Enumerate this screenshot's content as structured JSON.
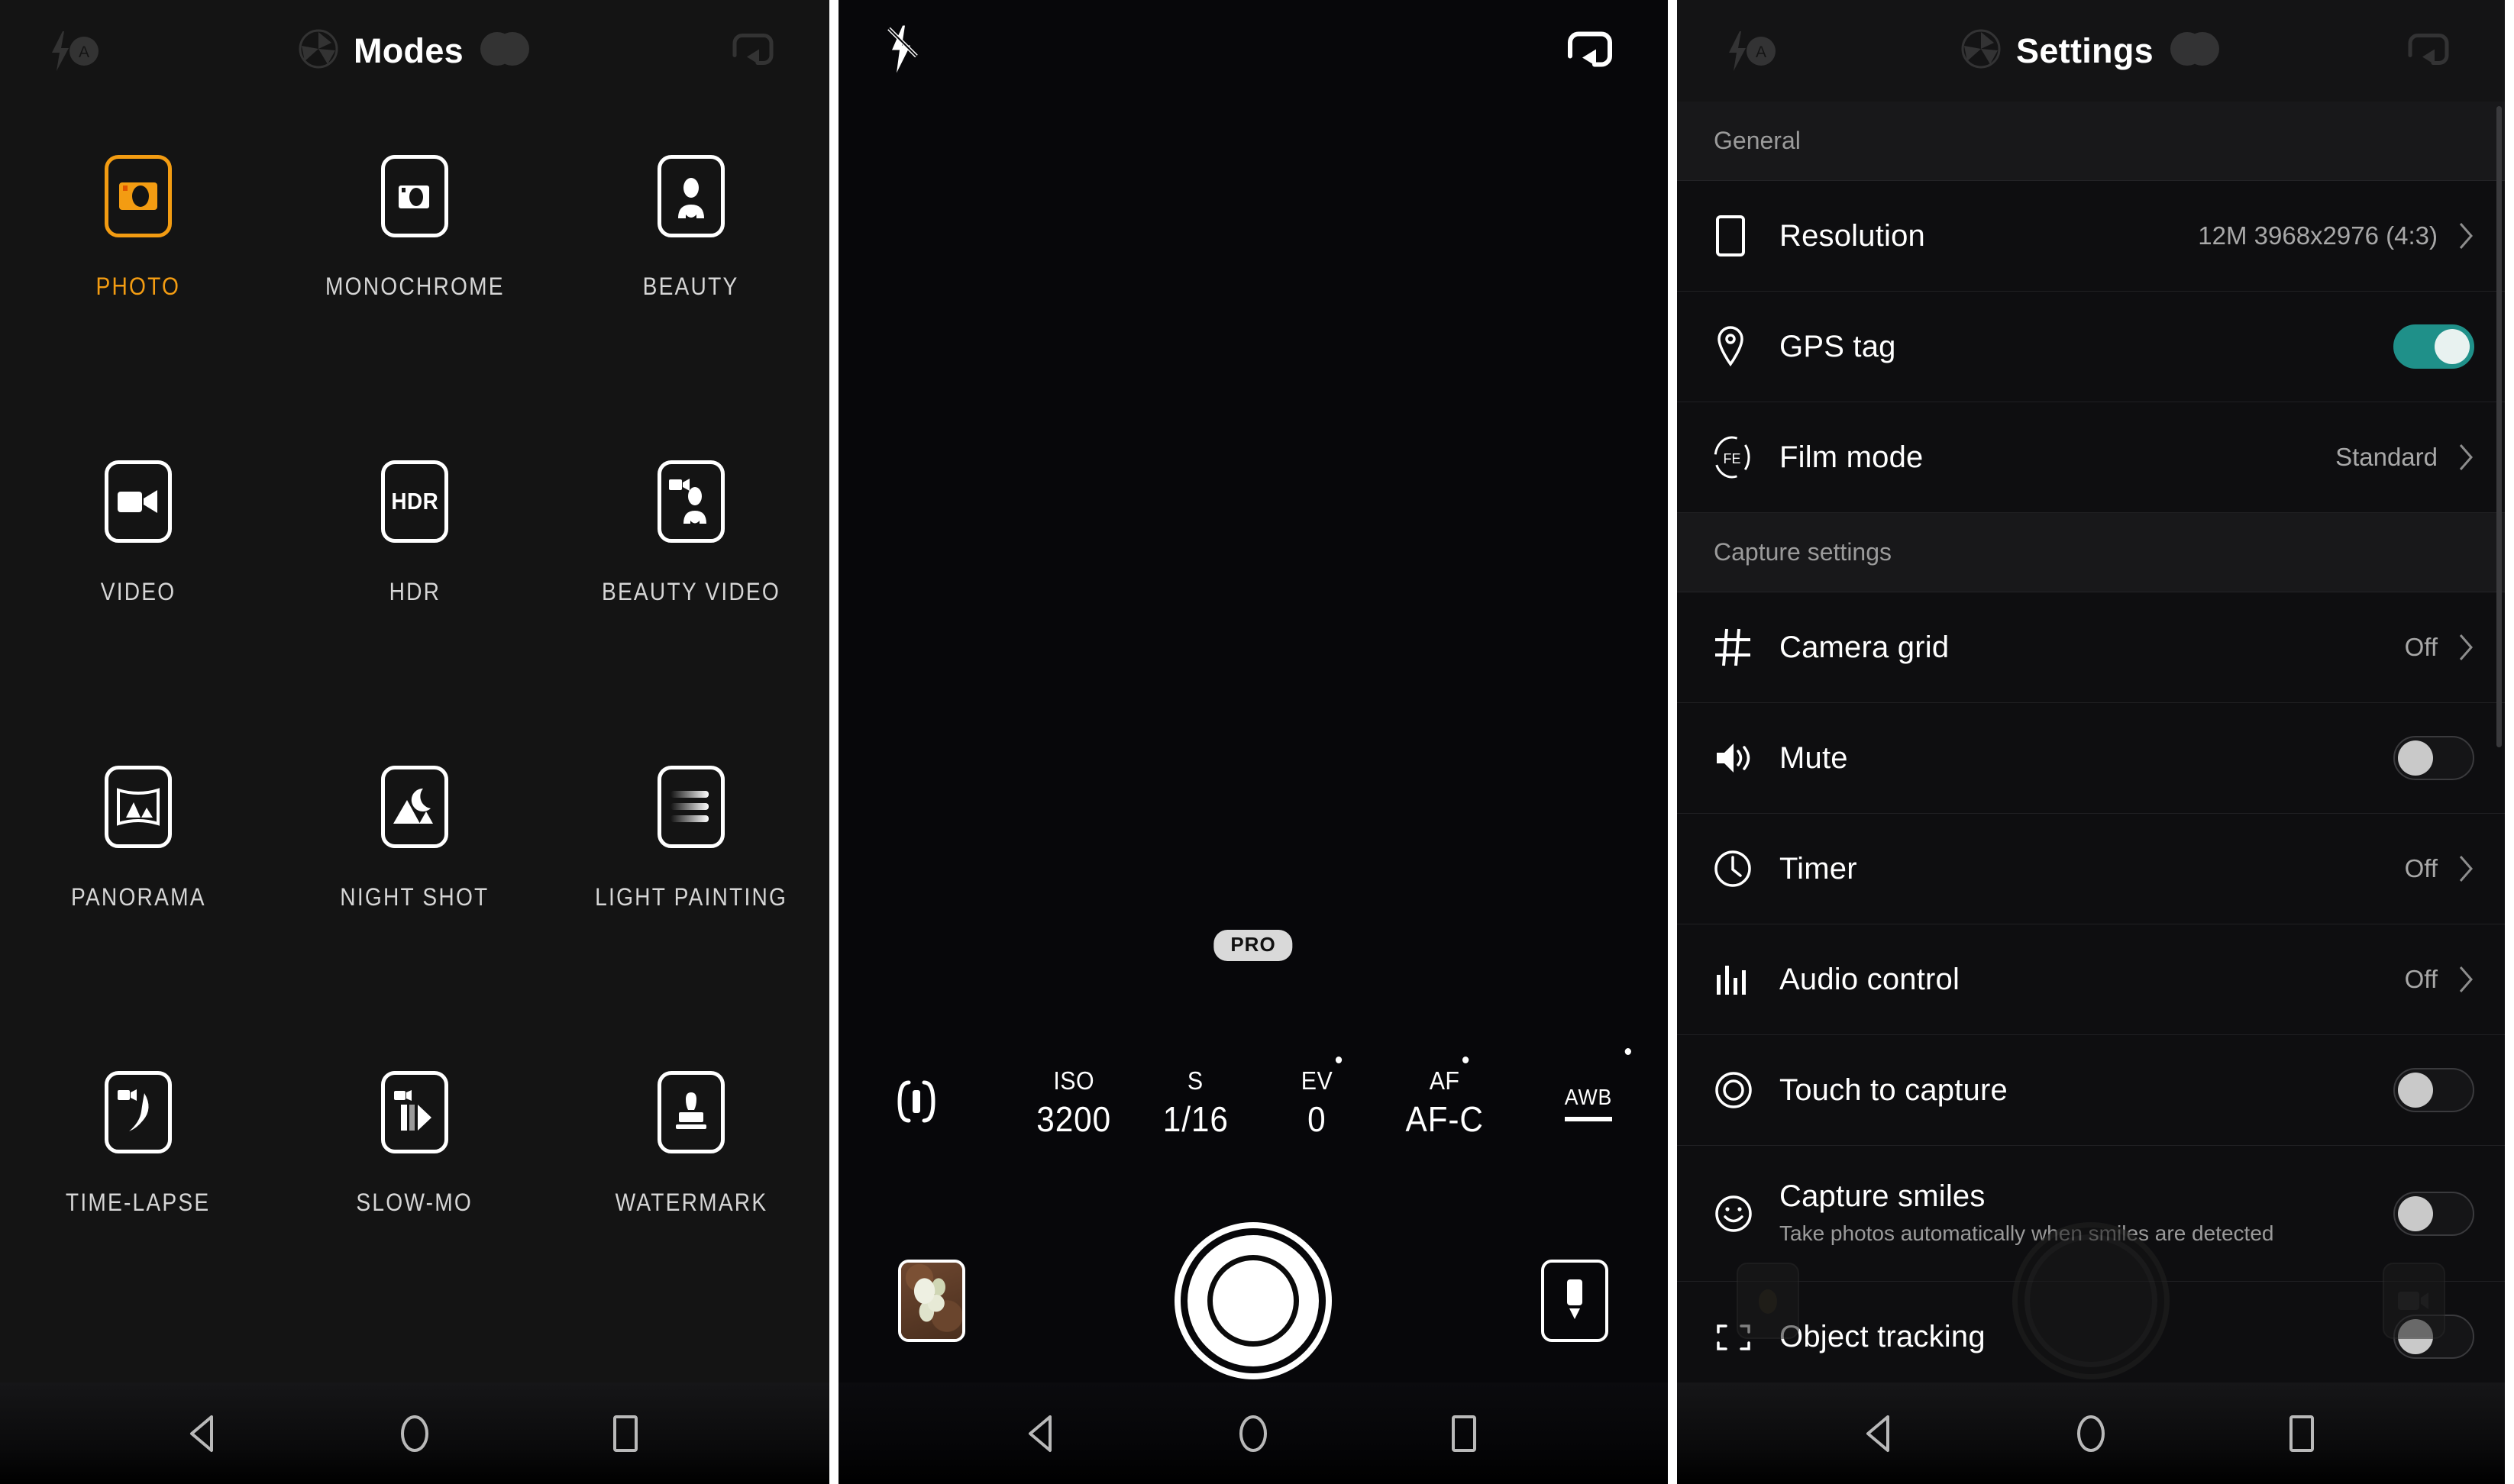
{
  "panels": {
    "modes": {
      "topbar": {
        "flash_icon": "flash-auto-icon",
        "aperture_icon": "aperture-icon",
        "title": "Modes",
        "filter_icon": "color-filter-icon",
        "switch_camera_icon": "switch-camera-icon"
      },
      "grid": [
        [
          {
            "label": "PHOTO",
            "icon": "photo-mode-icon",
            "selected": true
          },
          {
            "label": "MONOCHROME",
            "icon": "monochrome-mode-icon",
            "selected": false
          },
          {
            "label": "BEAUTY",
            "icon": "beauty-mode-icon",
            "selected": false
          }
        ],
        [
          {
            "label": "VIDEO",
            "icon": "video-mode-icon",
            "selected": false
          },
          {
            "label": "HDR",
            "icon": "hdr-mode-icon",
            "selected": false
          },
          {
            "label": "BEAUTY VIDEO",
            "icon": "beauty-video-mode-icon",
            "selected": false
          }
        ],
        [
          {
            "label": "PANORAMA",
            "icon": "panorama-mode-icon",
            "selected": false
          },
          {
            "label": "NIGHT SHOT",
            "icon": "night-shot-mode-icon",
            "selected": false
          },
          {
            "label": "LIGHT PAINTING",
            "icon": "light-painting-mode-icon",
            "selected": false
          }
        ],
        [
          {
            "label": "TIME-LAPSE",
            "icon": "time-lapse-mode-icon",
            "selected": false
          },
          {
            "label": "SLOW-MO",
            "icon": "slow-mo-mode-icon",
            "selected": false
          },
          {
            "label": "WATERMARK",
            "icon": "watermark-mode-icon",
            "selected": false
          }
        ]
      ],
      "hdr_badge_text": "HDR"
    },
    "viewfinder": {
      "topbar": {
        "flash_icon": "flash-off-icon",
        "switch_camera_icon": "switch-camera-icon"
      },
      "pro_badge": "PRO",
      "pro_controls": [
        {
          "key": "",
          "value": "",
          "icon": "metering-mode-icon",
          "name": "metering"
        },
        {
          "key": "ISO",
          "value": "3200",
          "name": "iso"
        },
        {
          "key": "S",
          "value": "1/16",
          "name": "shutter-speed"
        },
        {
          "key": "EV",
          "value": "0",
          "name": "exposure-value"
        },
        {
          "key": "AF",
          "value": "AF-C",
          "name": "focus-mode"
        },
        {
          "key": "AWB",
          "value": "",
          "name": "white-balance"
        }
      ],
      "bottom": {
        "gallery_thumb": "gallery-thumbnail",
        "shutter": "shutter-button",
        "mode_switch": "mode-switch-button"
      }
    },
    "settings": {
      "topbar": {
        "flash_icon": "flash-auto-icon",
        "aperture_icon": "aperture-icon",
        "title": "Settings",
        "filter_icon": "color-filter-icon",
        "switch_camera_icon": "switch-camera-icon"
      },
      "sections": [
        {
          "header": "General",
          "rows": [
            {
              "label": "Resolution",
              "value": "12M 3968x2976 (4:3)",
              "control": "chevron",
              "icon": "aspect-ratio-icon"
            },
            {
              "label": "GPS tag",
              "value": "",
              "control": "toggle",
              "toggle_on": true,
              "icon": "location-pin-icon"
            },
            {
              "label": "Film mode",
              "value": "Standard",
              "control": "chevron",
              "icon": "film-mode-icon"
            }
          ]
        },
        {
          "header": "Capture settings",
          "rows": [
            {
              "label": "Camera grid",
              "value": "Off",
              "control": "chevron",
              "icon": "grid-icon"
            },
            {
              "label": "Mute",
              "value": "",
              "control": "toggle",
              "toggle_on": false,
              "icon": "speaker-icon"
            },
            {
              "label": "Timer",
              "value": "Off",
              "control": "chevron",
              "icon": "clock-icon"
            },
            {
              "label": "Audio control",
              "value": "Off",
              "control": "chevron",
              "icon": "audio-levels-icon"
            },
            {
              "label": "Touch to capture",
              "value": "",
              "control": "toggle",
              "toggle_on": false,
              "icon": "target-icon"
            },
            {
              "label": "Capture smiles",
              "sub": "Take photos automatically when smiles are detected",
              "value": "",
              "control": "toggle",
              "toggle_on": false,
              "icon": "smiley-icon"
            },
            {
              "label": "Object tracking",
              "value": "",
              "control": "toggle",
              "toggle_on": false,
              "icon": "tracking-icon"
            }
          ]
        }
      ]
    }
  },
  "navbar": {
    "back": "back-nav-button",
    "home": "home-nav-button",
    "recents": "recents-nav-button"
  },
  "colors": {
    "accent_orange": "#f39c12",
    "toggle_on_teal": "#1f9089",
    "panel_bg": "#141414",
    "text_primary": "#ffffff",
    "text_secondary": "#9a9a9a"
  }
}
